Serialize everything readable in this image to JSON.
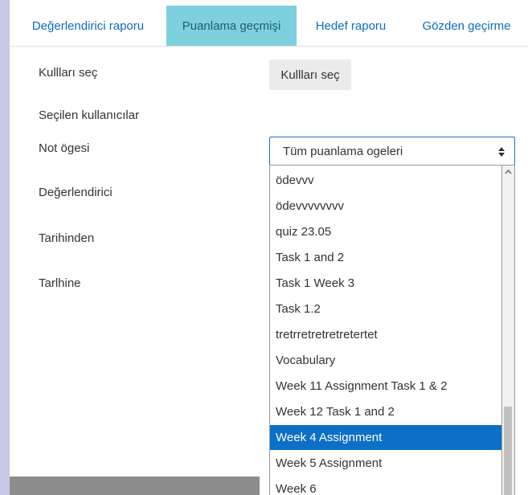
{
  "tabs": [
    {
      "label": "Değerlendirici raporu",
      "active": false
    },
    {
      "label": "Puanlama geçmişi",
      "active": true
    },
    {
      "label": "Hedef raporu",
      "active": false
    },
    {
      "label": "Gözden geçirme",
      "active": false
    }
  ],
  "form": {
    "select_users_label": "Kullları seç",
    "select_users_button": "Kullları seç",
    "selected_users_label": "Seçilen kullanıcılar",
    "grade_item_label": "Not ögesi",
    "grade_item_value": "Tüm puanlama ogeleri",
    "grader_label": "Değerlendirici",
    "date_from_label": "Tarihinden",
    "date_to_label": "Tarlhine"
  },
  "dropdown": {
    "options": [
      "ödevvv",
      "ödevvvvvvvv",
      "quiz 23.05",
      "Task 1 and 2",
      "Task 1 Week 3",
      "Task 1.2",
      "tretrretretretretertet",
      "Vocabulary",
      "Week 11 Assignment Task 1 & 2",
      "Week 12 Task 1 and 2",
      "Week 4 Assignment",
      "Week 5 Assignment",
      "Week 6"
    ],
    "selected_index": 10
  },
  "icons": {
    "select_arrows": "sort-arrows-icon",
    "scroll_up": "chevron-up-icon"
  },
  "colors": {
    "accent": "#0f6cbf",
    "active_tab": "#7fd0de",
    "selected_option": "#0d6fc6"
  }
}
